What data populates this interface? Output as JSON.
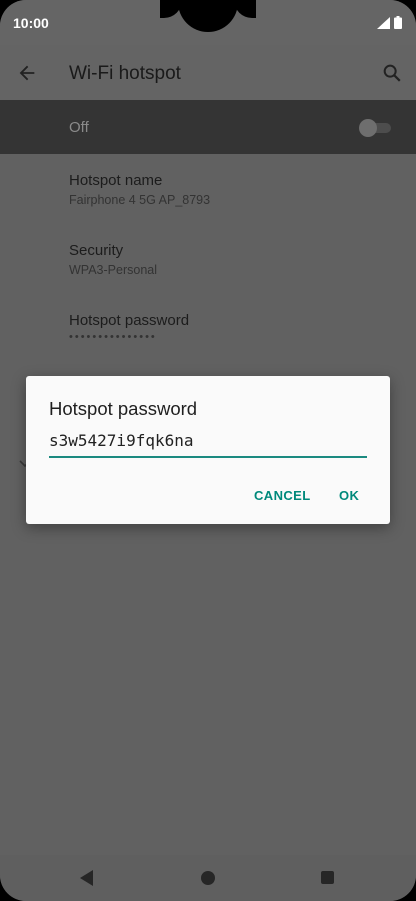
{
  "status_bar": {
    "time": "10:00"
  },
  "app_bar": {
    "title": "Wi-Fi hotspot"
  },
  "toggle": {
    "label": "Off",
    "on": false
  },
  "settings": [
    {
      "title": "Hotspot name",
      "subtitle": "Fairphone 4 5G AP_8793"
    },
    {
      "title": "Security",
      "subtitle": "WPA3-Personal"
    },
    {
      "title": "Hotspot password",
      "subtitle": "•••••••••••••••"
    }
  ],
  "dialog": {
    "title": "Hotspot password",
    "input_value": "s3w5427i9fqk6na",
    "cancel_label": "CANCEL",
    "ok_label": "OK"
  },
  "colors": {
    "accent": "#00897b",
    "underline": "#1b8a80"
  }
}
